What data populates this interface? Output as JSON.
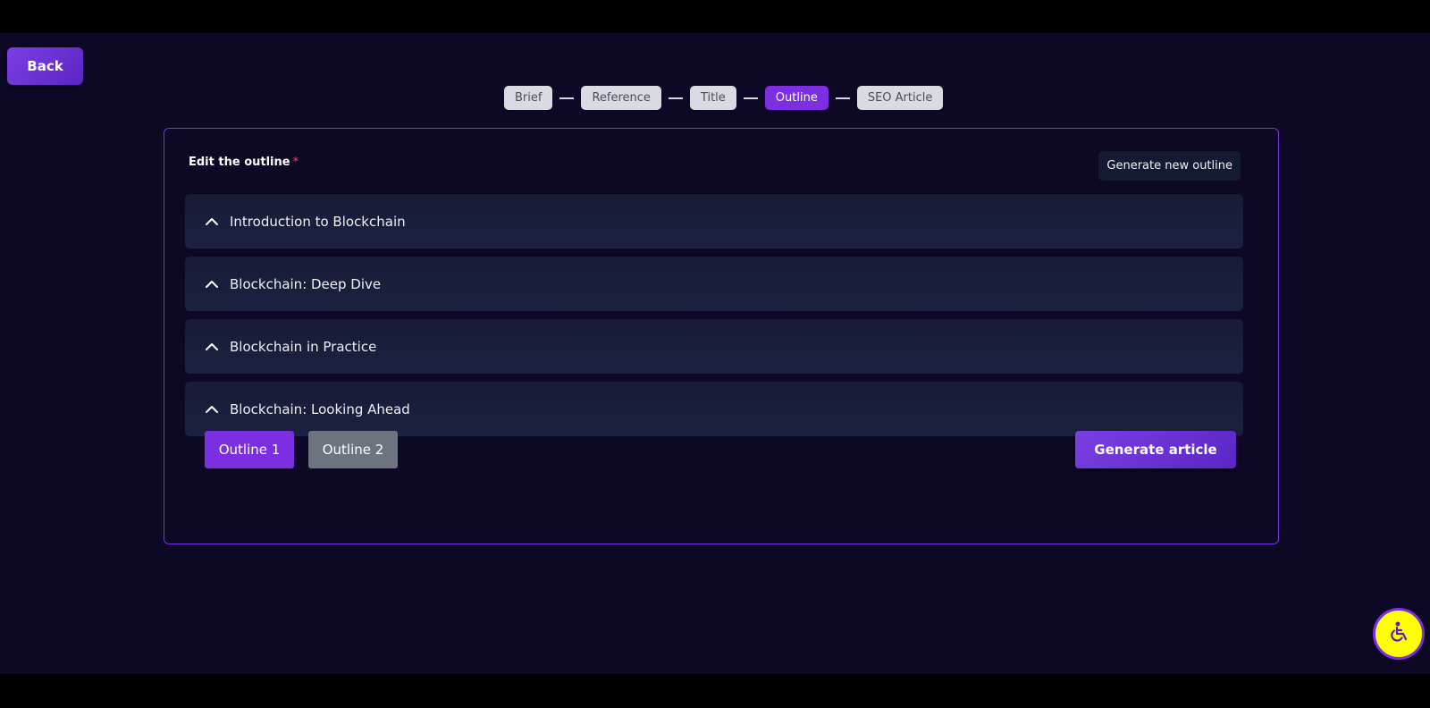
{
  "nav": {
    "back_label": "Back"
  },
  "stepper": {
    "steps": [
      {
        "label": "Brief",
        "active": false
      },
      {
        "label": "Reference",
        "active": false
      },
      {
        "label": "Title",
        "active": false
      },
      {
        "label": "Outline",
        "active": true
      },
      {
        "label": "SEO Article",
        "active": false
      }
    ]
  },
  "editor": {
    "label": "Edit the outline",
    "required_marker": "*",
    "generate_new_label": "Generate new outline",
    "sections": [
      {
        "title": "Introduction to Blockchain",
        "icon": "chevron-up-icon"
      },
      {
        "title": "Blockchain: Deep Dive",
        "icon": "chevron-up-icon"
      },
      {
        "title": "Blockchain in Practice",
        "icon": "chevron-up-icon"
      },
      {
        "title": "Blockchain: Looking Ahead",
        "icon": "chevron-up-icon"
      }
    ],
    "outline_tabs": [
      {
        "label": "Outline 1",
        "selected": true
      },
      {
        "label": "Outline 2",
        "selected": false
      }
    ],
    "generate_article_label": "Generate article"
  },
  "accessibility": {
    "icon": "wheelchair-icon"
  },
  "colors": {
    "background": "#0d0826",
    "accent": "#7b2fe0",
    "accessibility_button": "#ffff00"
  }
}
